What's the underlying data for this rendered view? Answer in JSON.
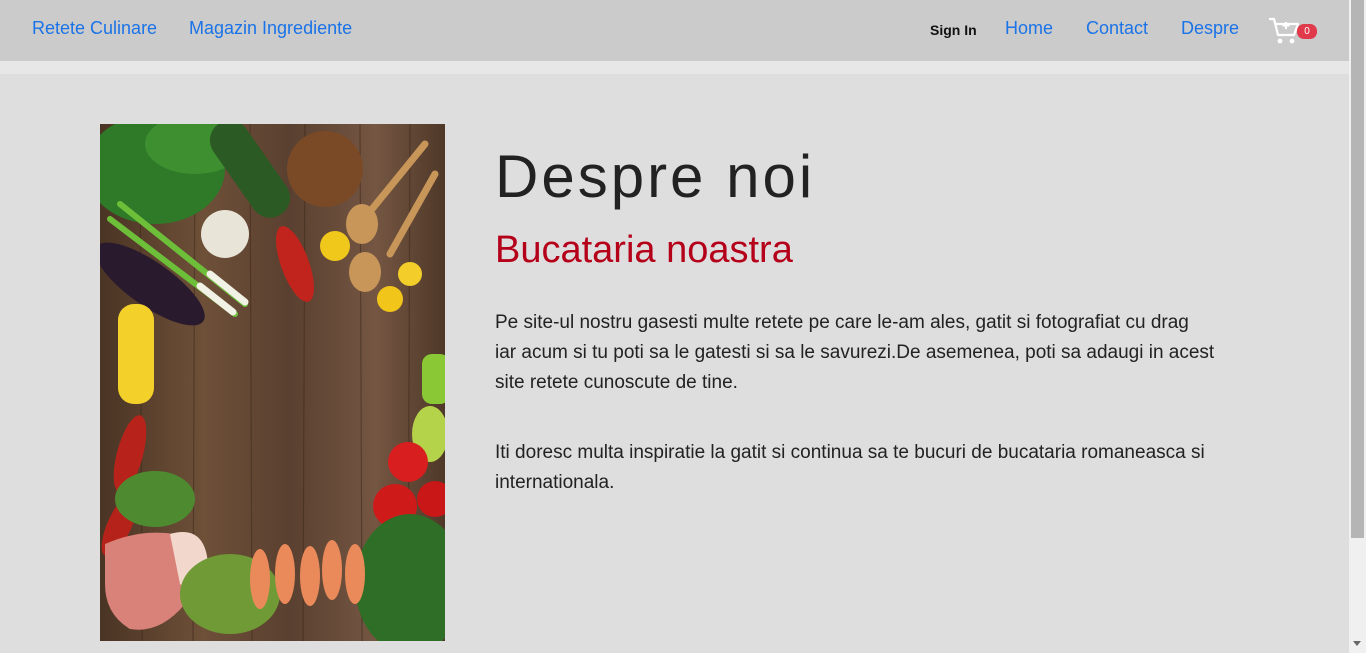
{
  "nav": {
    "brand_links": [
      "Retete Culinare",
      "Magazin Ingrediente"
    ],
    "signin": "Sign In",
    "links": [
      "Home",
      "Contact",
      "Despre"
    ],
    "cart_icon": "cart-icon",
    "cart_count": "0",
    "link_color": "#1a73e8"
  },
  "about": {
    "title": "Despre noi",
    "subtitle": "Bucataria noastra",
    "paragraph1": "Pe site-ul nostru gasesti multe retete pe care le-am ales, gatit si fotografiat cu drag iar acum si tu poti sa le gatesti si sa le savurezi.De asemenea, poti sa adaugi in acest site retete cunoscute de tine.",
    "paragraph2": "Iti doresc multa inspiratie la gatit si continua sa te bucuri de bucataria romaneasca si internationala.",
    "accent_color": "#b5001a"
  }
}
